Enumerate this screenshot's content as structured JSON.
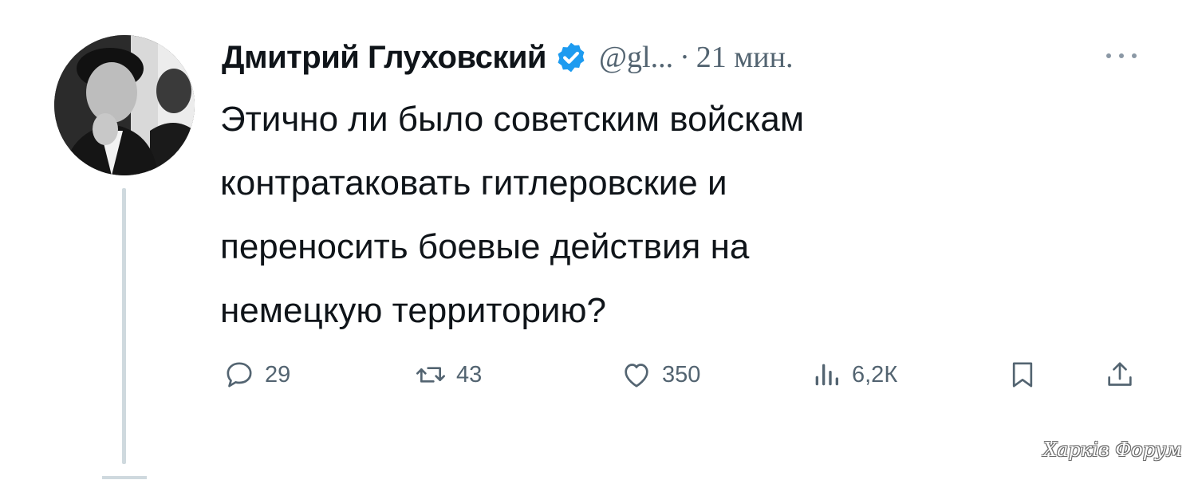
{
  "author": {
    "name": "Дмитрий Глуховский",
    "handle": "@gl...",
    "separator": "·",
    "time": "21 мин.",
    "verified": true
  },
  "tweet": {
    "lines": [
      "Этично ли было советским войскам",
      "контратаковать гитлеровские и",
      "переносить боевые действия на",
      "немецкую территорию?"
    ]
  },
  "actions": {
    "replies": "29",
    "reposts": "43",
    "likes": "350",
    "views": "6,2К"
  },
  "watermark": "Харків Форум",
  "colors": {
    "text": "#0f1419",
    "muted": "#536471",
    "verified": "#1d9bf0",
    "thread_line": "#cfd9de"
  },
  "icons": [
    "reply-icon",
    "repost-icon",
    "like-icon",
    "views-icon",
    "bookmark-icon",
    "share-icon",
    "more-icon",
    "verified-badge-icon"
  ]
}
